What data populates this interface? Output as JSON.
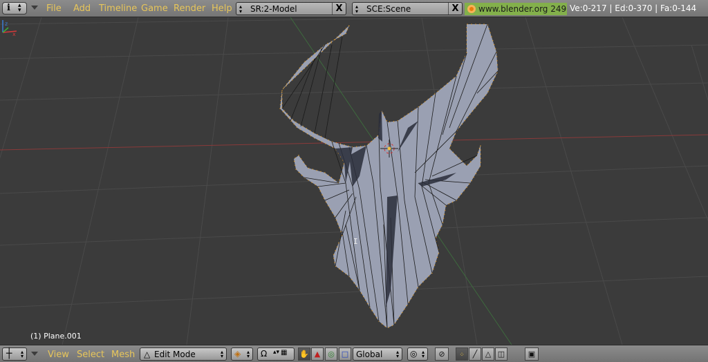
{
  "top_header": {
    "menus": [
      "File",
      "Add",
      "Timeline",
      "Game",
      "Render",
      "Help"
    ],
    "screen_field": "SR:2-Model",
    "scene_field": "SCE:Scene",
    "close_glyph": "X",
    "website": "www.blender.org 249.2",
    "stats": "Ve:0-217 | Ed:0-370 | Fa:0-144"
  },
  "viewport": {
    "object_label": "(1) Plane.001",
    "grid_color": "#4a4a4a",
    "x_axis_color": "#8a3a3a",
    "y_axis_color": "#3e6a3e",
    "mesh_fill": "#9aa0b2",
    "vertex_color": "#f0a020",
    "edge_color": "#1a1a1a"
  },
  "bottom_header": {
    "menus": [
      "View",
      "Select",
      "Mesh"
    ],
    "mode": "Edit Mode",
    "orientation": "Global",
    "icons": [
      "viewport-type-icon",
      "draw-type-icon",
      "pivot-icon",
      "manipulator-hand-icon",
      "translate-icon",
      "rotate-icon",
      "scale-icon",
      "proportional-icon",
      "vertex-select-icon",
      "edge-select-icon",
      "face-select-icon",
      "occlude-icon",
      "render-preview-icon"
    ]
  }
}
